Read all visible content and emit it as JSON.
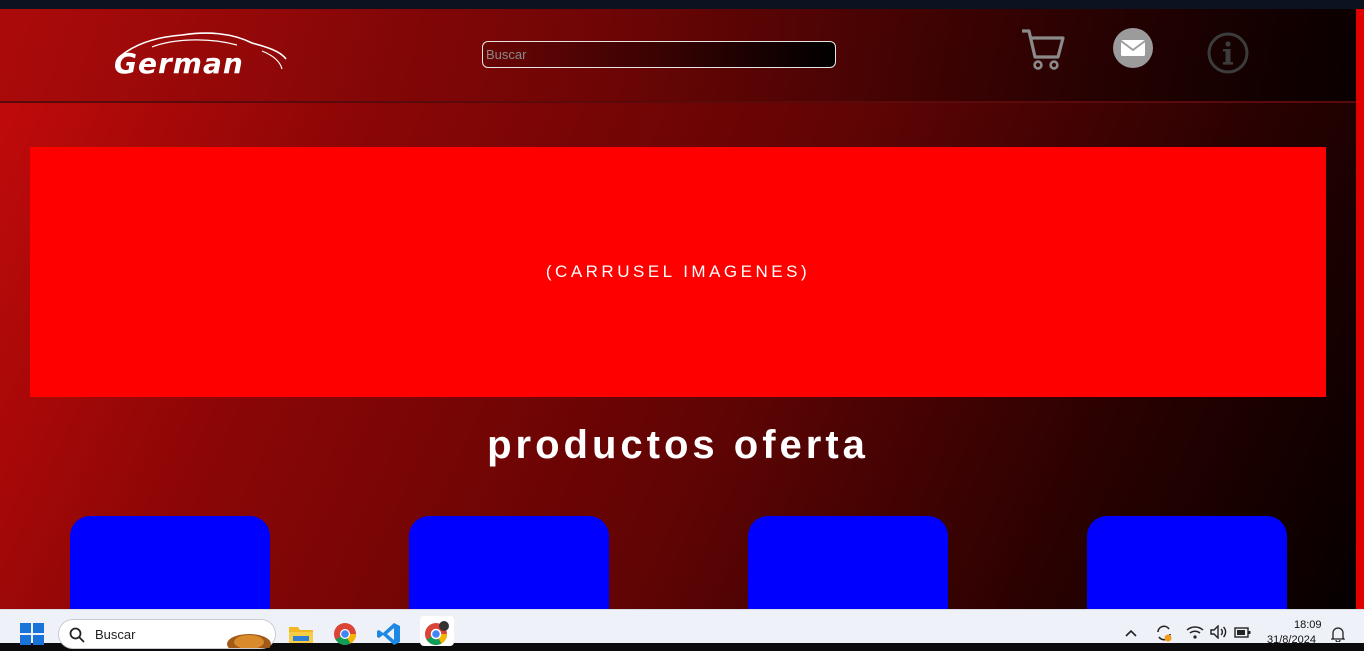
{
  "brand": {
    "name": "German"
  },
  "header": {
    "search_placeholder": "Buscar",
    "icons": [
      "shopping-cart-icon",
      "mail-icon",
      "info-icon"
    ]
  },
  "carousel": {
    "label": "(CARRUSEL IMAGENES)"
  },
  "offers": {
    "title": "productos oferta",
    "cards": [
      {},
      {},
      {},
      {}
    ]
  },
  "colors": {
    "carousel_bg": "#ff0000",
    "card_bg": "#0000ff",
    "page_gradient_start": "#c60b0b",
    "page_gradient_end": "#050000"
  },
  "taskbar": {
    "search_label": "Buscar",
    "apps": [
      "file-explorer-icon",
      "chrome-icon",
      "vscode-icon",
      "chrome-dev-icon"
    ],
    "time": "18:09",
    "date": "31/8/2024"
  }
}
